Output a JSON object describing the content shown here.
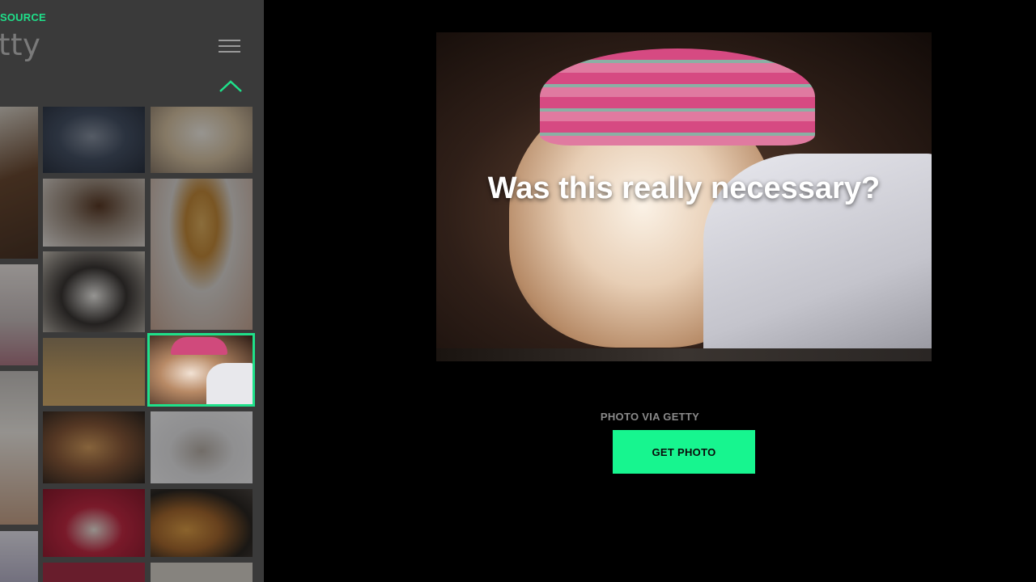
{
  "sidebar": {
    "source_label": "SOURCE",
    "brand": "tty",
    "menu_icon": "hamburger-icon",
    "collapse_icon": "chevron-up-icon",
    "accent_color": "#1fe08a",
    "thumbnails": [
      {
        "name": "thumb-cat-pink-hat"
      },
      {
        "name": "thumb-cat-chef-hat"
      },
      {
        "name": "thumb-cat-brown-hat"
      },
      {
        "name": "thumb-dog-lion-mane"
      },
      {
        "name": "thumb-cat-blue-hat"
      },
      {
        "name": "thumb-cat-straw-hat"
      },
      {
        "name": "thumb-cat-knit-hat",
        "selected": true
      },
      {
        "name": "thumb-cat-santa-hat"
      },
      {
        "name": "thumb-kitten-santa-hat"
      },
      {
        "name": "thumb-guinea-pig-santa"
      },
      {
        "name": "thumb-cat-party-hat"
      }
    ]
  },
  "main": {
    "caption": "Was this really necessary?",
    "credit": "PHOTO VIA GETTY",
    "button_label": "GET PHOTO",
    "button_color": "#17f58f"
  }
}
